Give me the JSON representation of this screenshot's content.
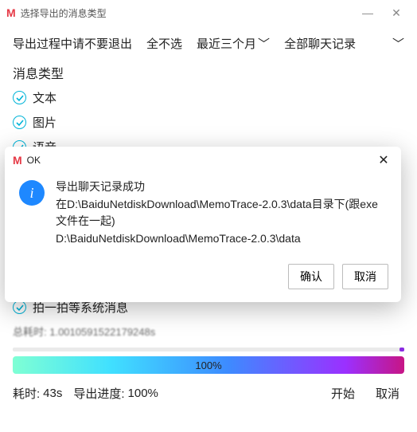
{
  "window": {
    "icon_letter": "M",
    "title": "选择导出的消息类型"
  },
  "toolbar": {
    "warning": "导出过程中请不要退出",
    "deselect_all": "全不选",
    "time_range": "最近三个月",
    "scope": "全部聊天记录"
  },
  "section_title": "消息类型",
  "options": [
    {
      "label": "文本",
      "checked": true
    },
    {
      "label": "图片",
      "checked": true
    },
    {
      "label": "语音",
      "checked": true
    },
    {
      "label": "拍一拍等系统消息",
      "checked": true
    }
  ],
  "hidden_total_line": "总耗时: 1.0010591522179248s",
  "progress": {
    "percent_text": "100%",
    "value": 100
  },
  "footer": {
    "elapsed_label": "耗时:",
    "elapsed_value": "43s",
    "progress_label": "导出进度:",
    "progress_value": "100%",
    "start": "开始",
    "cancel": "取消"
  },
  "modal": {
    "icon_letter": "M",
    "title": "OK",
    "line1": "导出聊天记录成功",
    "line2": "在D:\\BaiduNetdiskDownload\\MemoTrace-2.0.3\\data目录下(跟exe文件在一起)",
    "line3": "D:\\BaiduNetdiskDownload\\MemoTrace-2.0.3\\data",
    "confirm": "确认",
    "cancel": "取消"
  }
}
